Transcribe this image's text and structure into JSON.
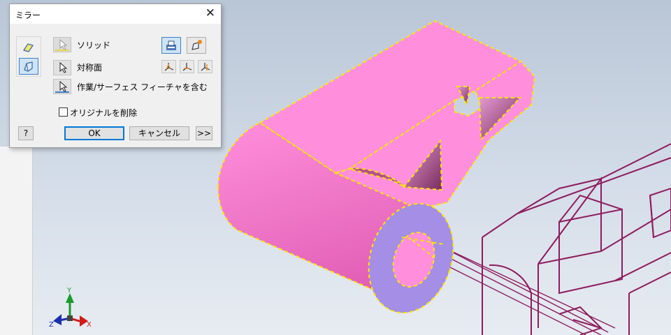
{
  "dialog": {
    "title": "ミラー",
    "close_label": "✕",
    "rows": {
      "solid_label": "ソリッド",
      "symmetry_label": "対称面",
      "work_surface_label": "作業/サーフェス フィーチャを含む"
    },
    "delete_original_label": "オリジナルを削除",
    "delete_original_checked": false,
    "ok_label": "OK",
    "cancel_label": "キャンセル",
    "more_label": ">>",
    "help_label": "?"
  },
  "viewcube_axes": {
    "x": "X",
    "y": "Y",
    "z": "Z"
  },
  "colors": {
    "part_pink": "#ff8fdc",
    "end_face": "#a48ee6",
    "selection_dash": "#ffe600",
    "sketch_lines": "#8f1b5e",
    "active_blue": "#3d7fc4"
  }
}
